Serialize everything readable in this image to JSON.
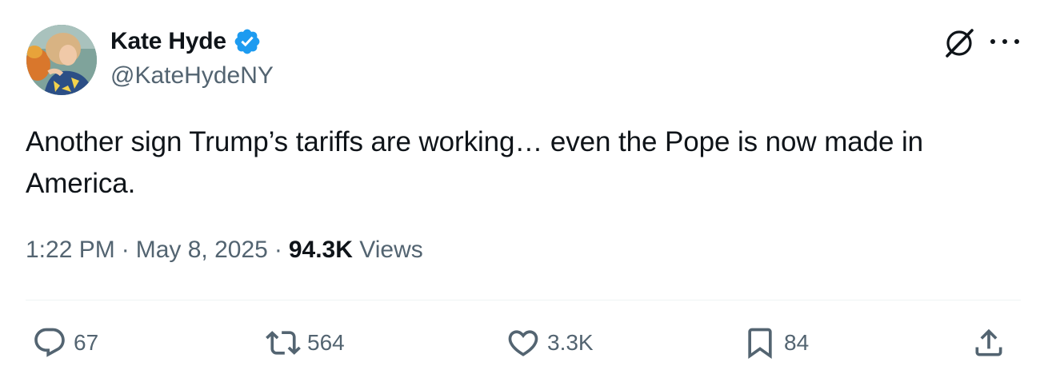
{
  "author": {
    "display_name": "Kate Hyde",
    "handle": "@KateHydeNY",
    "verified": true,
    "avatar_icon": "profile-photo"
  },
  "tweet": {
    "text": "Another sign Trump’s tariffs are working… even the Pope is now made in America."
  },
  "meta": {
    "time": "1:22 PM",
    "separator": "·",
    "date": "May 8, 2025",
    "views_count": "94.3K",
    "views_label": "Views"
  },
  "actions": {
    "replies": "67",
    "reposts": "564",
    "likes": "3.3K",
    "bookmarks": "84"
  },
  "colors": {
    "text": "#0f1419",
    "secondary": "#536471",
    "verified_blue": "#1d9bf0",
    "divider": "#eff3f4"
  }
}
